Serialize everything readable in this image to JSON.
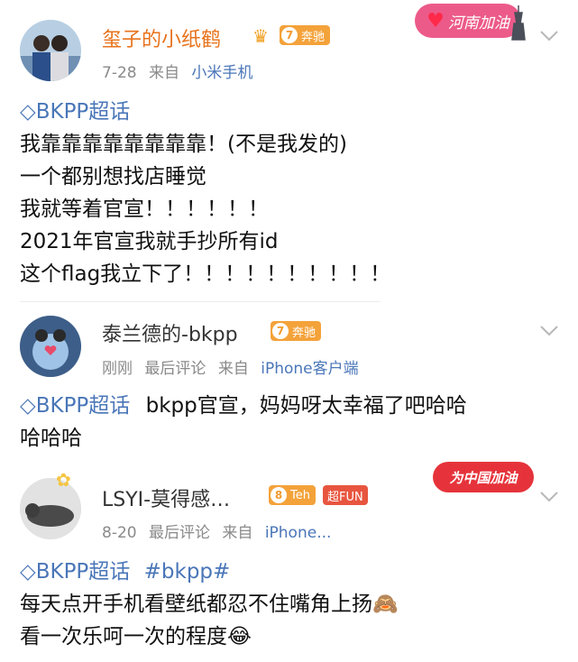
{
  "posts": [
    {
      "username": "玺子的小纸鹤",
      "level": "7",
      "level_label": "奔驰",
      "date": "7-28",
      "source_prefix": "来自",
      "source": "小米手机",
      "topic": "BKPP超话",
      "lines": [
        "我靠靠靠靠靠靠靠靠！(不是我发的)",
        "一个都别想找店睡觉",
        "我就等着官宣！！！！！！",
        "2021年官宣我就手抄所有id",
        "这个flag我立下了！！！！！！！！！！"
      ],
      "sticker": "河南加油"
    },
    {
      "username": "泰兰德的-bkpp",
      "level": "7",
      "level_label": "奔驰",
      "date": "刚刚",
      "comment_label": "最后评论",
      "source_prefix": "来自",
      "source": "iPhone客户端",
      "topic": "BKPP超话",
      "text_line1": "bkpp官宣，妈妈呀太幸福了吧哈哈",
      "text_line2": "哈哈哈"
    },
    {
      "username": "LSYI-莫得感…",
      "level": "8",
      "level_label": "Teh",
      "fun_label": "超FUN",
      "date": "8-20",
      "comment_label": "最后评论",
      "source_prefix": "来自",
      "source": "iPhone...",
      "topic": "BKPP超话",
      "hashtag": "#bkpp#",
      "line1": "每天点开手机看壁纸都忍不住嘴角上扬🙈",
      "line2": "看一次乐呵一次的程度😂",
      "sticker": "为中国加油"
    }
  ]
}
